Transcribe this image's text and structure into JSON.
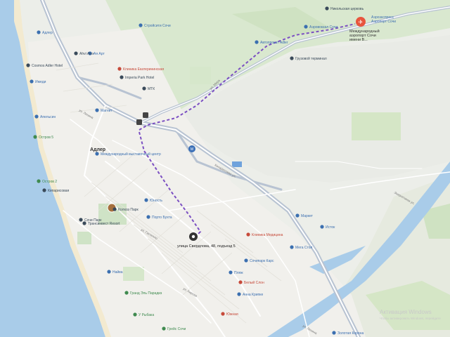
{
  "map": {
    "district": "Адлер",
    "route": {
      "origin": "улица Свердлова, 48, подъезд 5",
      "destination_line1": "Международный",
      "destination_line2": "аэропорт Сочи",
      "destination_line3": "имени В...",
      "terminal_line1": "Аэроэкспресс",
      "terminal_line2": "Аэропорт Сочи"
    },
    "pois": [
      {
        "name": "Аэровокзал Сочи",
        "color": "#3b6fb0"
      },
      {
        "name": "Грузовой терминал",
        "color": "#3a4a5a"
      },
      {
        "name": "Никольская церковь",
        "color": "#3a4a5a"
      },
      {
        "name": "Автопрокат Adler",
        "color": "#3b6fb0"
      },
      {
        "name": "Стройсити Сочи",
        "color": "#3b6fb0"
      },
      {
        "name": "Адлер",
        "color": "#3b6fb0"
      },
      {
        "name": "Ahvi Alex",
        "color": "#3a4a5a"
      },
      {
        "name": "Ая Арт",
        "color": "#3b6fb0"
      },
      {
        "name": "Cosmos Adler Hotel",
        "color": "#3a4a5a"
      },
      {
        "name": "Imperia Park Hotel",
        "color": "#3a4a5a"
      },
      {
        "name": "Клиника Екатерининская",
        "color": "#c74a3a"
      },
      {
        "name": "Имеди",
        "color": "#3b6fb0"
      },
      {
        "name": "МТК",
        "color": "#3a4a5a"
      },
      {
        "name": "Апельсин",
        "color": "#3b6fb0"
      },
      {
        "name": "Магнит",
        "color": "#3b6fb0"
      },
      {
        "name": "Остров 5",
        "color": "#3f8a4f"
      },
      {
        "name": "Международный выставочный центр",
        "color": "#3b6fb0"
      },
      {
        "name": "Остров 2",
        "color": "#3f8a4f"
      },
      {
        "name": "Кипарисовая",
        "color": "#3a4a5a"
      },
      {
        "name": "Юность",
        "color": "#3b6fb0"
      },
      {
        "name": "Колхоз Парк",
        "color": "#3a4a5a"
      },
      {
        "name": "Сочи Парк",
        "color": "#3a4a5a"
      },
      {
        "name": "Порто Бухта",
        "color": "#3b6fb0"
      },
      {
        "name": "Маркет",
        "color": "#3b6fb0"
      },
      {
        "name": "Исток",
        "color": "#3b6fb0"
      },
      {
        "name": "Клиника Медицина",
        "color": "#c74a3a"
      },
      {
        "name": "Мега Стол",
        "color": "#3b6fb0"
      },
      {
        "name": "Пляж",
        "color": "#3b6fb0"
      },
      {
        "name": "Сочипарк Карс",
        "color": "#3b6fb0"
      },
      {
        "name": "Белый Слон",
        "color": "#c74a3a"
      },
      {
        "name": "Анна Крипке",
        "color": "#3b6fb0"
      },
      {
        "name": "Найва",
        "color": "#3b6fb0"
      },
      {
        "name": "Гранд Эль Парадиз",
        "color": "#3f8a4f"
      },
      {
        "name": "У Рыбака",
        "color": "#3f8a4f"
      },
      {
        "name": "Южная",
        "color": "#c74a3a"
      },
      {
        "name": "Грейс Сочи",
        "color": "#3f8a4f"
      },
      {
        "name": "Золотая Корона",
        "color": "#3b6fb0"
      },
      {
        "name": "Трансинвест Resort",
        "color": "#3a4a5a"
      }
    ],
    "streets": [
      "ул. Мира",
      "ул. Ленина",
      "Кипарисовая ул.",
      "ул. Гастелло",
      "ул. Кирова",
      "Энергетиков ул.",
      "ул. Ленина"
    ],
    "watermark_line1": "Активация Windows",
    "watermark_line2": "Чтобы активировать Windows, перейдите"
  },
  "colors": {
    "sea": "#a9cce9",
    "river": "#a9cce9",
    "route": "#7b4fc2",
    "highway": "#b8c3d2",
    "airport_marker": "#e8553d"
  }
}
